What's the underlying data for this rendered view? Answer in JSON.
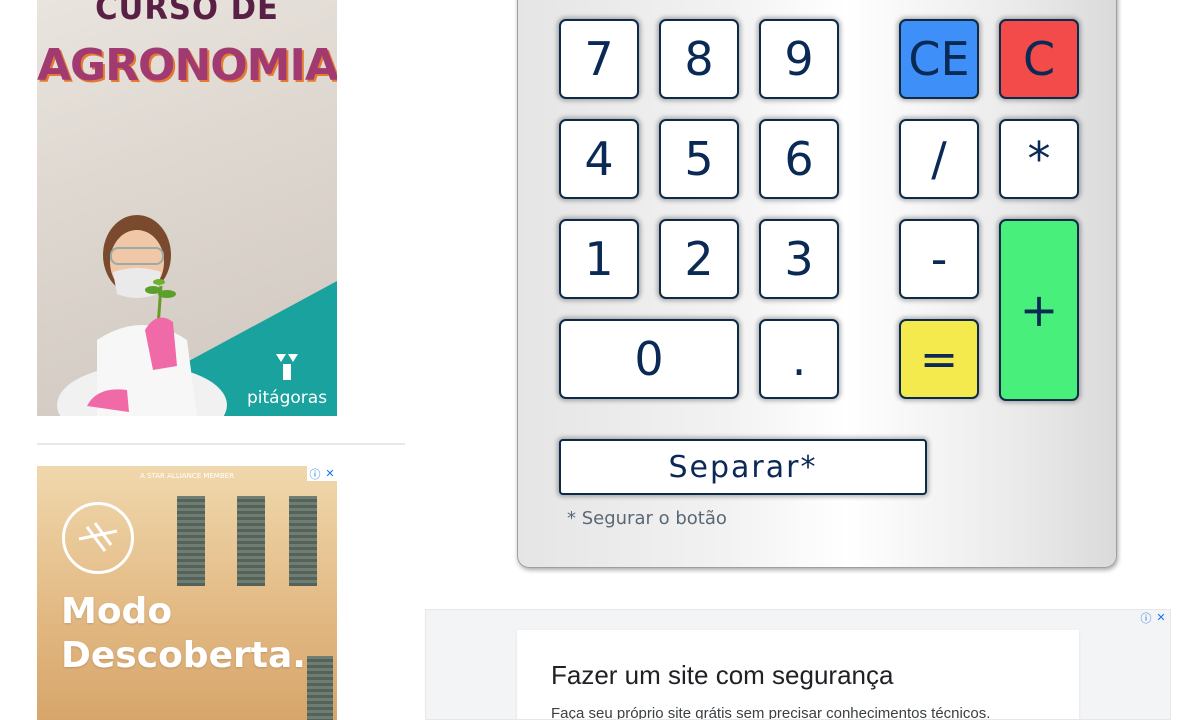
{
  "ads": {
    "agronomia": {
      "headline_line1": "CURSO DE",
      "headline_line2": "AGRONOMIA",
      "brand": "pitágoras",
      "colors": {
        "headline": "#a23a72",
        "accent": "#1aa29f"
      }
    },
    "lufthansa": {
      "member_text": "A STAR ALLIANCE MEMBER",
      "slogan_line1": "Modo",
      "slogan_line2": "Descoberta.",
      "adchoice_icon": "info-icon",
      "close_icon": "close-icon"
    },
    "bottom": {
      "title": "Fazer um site com segurança",
      "description": "Faça seu próprio site grátis sem precisar conhecimentos técnicos."
    }
  },
  "calculator": {
    "keys": {
      "k7": "7",
      "k8": "8",
      "k9": "9",
      "k4": "4",
      "k5": "5",
      "k6": "6",
      "k1": "1",
      "k2": "2",
      "k3": "3",
      "k0": "0",
      "dot": ".",
      "ce": "CE",
      "c": "C",
      "divide": "/",
      "multiply": "*",
      "minus": "-",
      "plus": "+",
      "equals": "="
    },
    "separate_label": "Separar*",
    "hint": "* Segurar o botão",
    "colors": {
      "ce": "#3e8ff7",
      "c": "#f34a4a",
      "equals": "#f5ea4d",
      "plus": "#48f07b",
      "text": "#0a2a55"
    }
  }
}
